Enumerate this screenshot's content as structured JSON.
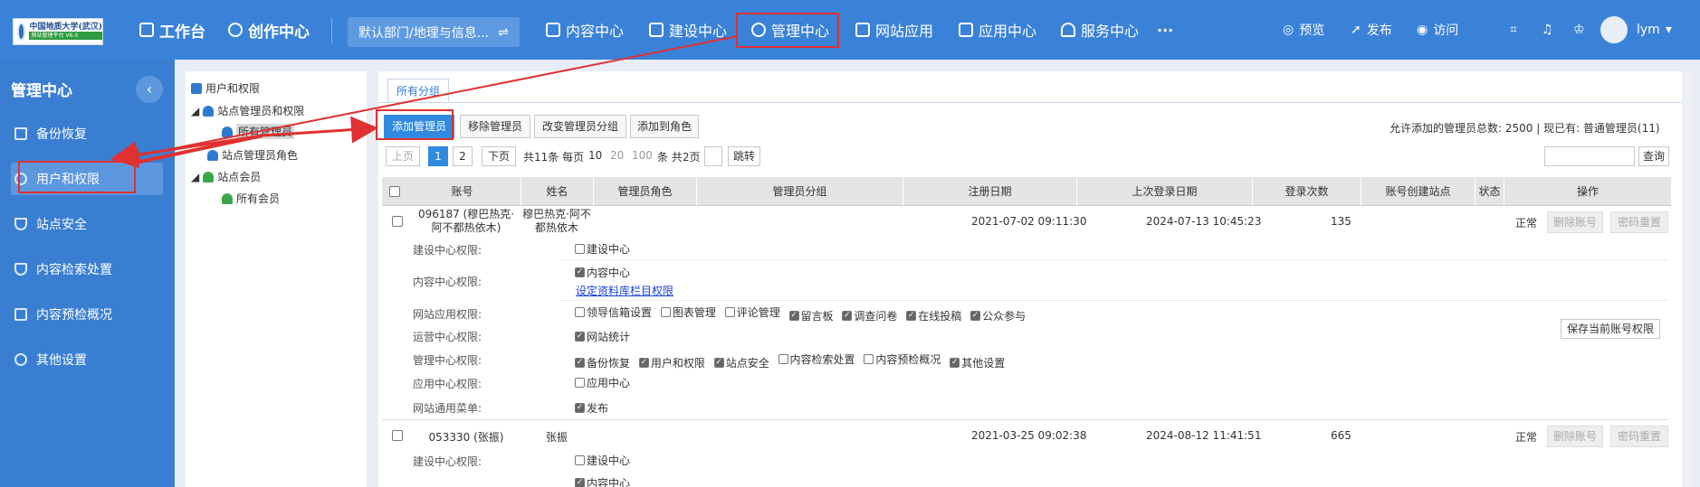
{
  "logo": {
    "line1": "中国地质大学(武汉)",
    "line2": "网站管理平台 V6.0"
  },
  "topnav": {
    "workbench": "工作台",
    "creation": "创作中心",
    "dept": "默认部门/地理与信息...",
    "dept_icon": "swap-icon",
    "items": [
      "内容中心",
      "建设中心",
      "管理中心",
      "网站应用",
      "应用中心",
      "服务中心"
    ],
    "more": "···",
    "preview": "预览",
    "publish": "发布",
    "visit": "访问",
    "user": "lym"
  },
  "sidebar": {
    "title": "管理中心",
    "collapse": "‹",
    "items": [
      "备份恢复",
      "用户和权限",
      "站点安全",
      "内容检索处置",
      "内容预检概况",
      "其他设置"
    ]
  },
  "tree": {
    "root": "用户和权限",
    "admins": "站点管理员和权限",
    "all_admins": "所有管理员",
    "admin_roles": "站点管理员角色",
    "members": "站点会员",
    "all_members": "所有会员"
  },
  "main": {
    "tab": "所有分组",
    "buttons": {
      "add": "添加管理员",
      "remove": "移除管理员",
      "change_group": "改变管理员分组",
      "add_role": "添加到角色"
    },
    "quota": "允许添加的管理员总数: 2500 | 现已有: 普通管理员(11)",
    "search_button": "查询",
    "pager": {
      "prev": "上页",
      "p1": "1",
      "p2": "2",
      "next": "下页",
      "total": "共11条 每页",
      "s10": "10",
      "s20": "20",
      "s100": "100",
      "pages": "条 共2页",
      "jump": "跳转"
    },
    "columns": [
      "账号",
      "姓名",
      "管理员角色",
      "管理员分组",
      "注册日期",
      "上次登录日期",
      "登录次数",
      "账号创建站点",
      "状态",
      "操作"
    ],
    "rows": [
      {
        "account": "096187 (穆巴热克·阿不都热依木)",
        "name": "穆巴热克·阿不都热依木",
        "reg": "2021-07-02 09:11:30",
        "last": "2024-07-13 10:45:23",
        "count": "135",
        "status": "正常"
      },
      {
        "account": "053330 (张振)",
        "name": "张振",
        "reg": "2021-03-25 09:02:38",
        "last": "2024-08-12 11:41:51",
        "count": "665",
        "status": "正常"
      }
    ],
    "op_delete": "删除账号",
    "op_reset": "密码重置",
    "save_perm": "保存当前账号权限",
    "perm_labels": [
      "建设中心权限:",
      "内容中心权限:",
      "网站应用权限:",
      "运营中心权限:",
      "管理中心权限:",
      "应用中心权限:",
      "网站通用菜单:"
    ],
    "perm_build": [
      {
        "t": "建设中心",
        "on": false
      }
    ],
    "perm_content": [
      {
        "t": "内容中心",
        "on": true
      }
    ],
    "perm_content_link": "设定资料库栏目权限",
    "perm_app": [
      {
        "t": "领导信箱设置",
        "on": false
      },
      {
        "t": "图表管理",
        "on": false
      },
      {
        "t": "评论管理",
        "on": false
      },
      {
        "t": "留言板",
        "on": true
      },
      {
        "t": "调查问卷",
        "on": true
      },
      {
        "t": "在线投稿",
        "on": true
      },
      {
        "t": "公众参与",
        "on": true
      }
    ],
    "perm_ops": [
      {
        "t": "网站统计",
        "on": true
      }
    ],
    "perm_mgmt": [
      {
        "t": "备份恢复",
        "on": true
      },
      {
        "t": "用户和权限",
        "on": true
      },
      {
        "t": "站点安全",
        "on": true
      },
      {
        "t": "内容检索处置",
        "on": false
      },
      {
        "t": "内容预检概况",
        "on": false
      },
      {
        "t": "其他设置",
        "on": true
      }
    ],
    "perm_appc": [
      {
        "t": "应用中心",
        "on": false
      }
    ],
    "perm_menu": [
      {
        "t": "发布",
        "on": true
      }
    ]
  },
  "colors": {
    "topbar": "#3a82d8",
    "sidebar": "#3a7ed2",
    "primary": "#2f8ae0",
    "highlight": "#e03030"
  }
}
